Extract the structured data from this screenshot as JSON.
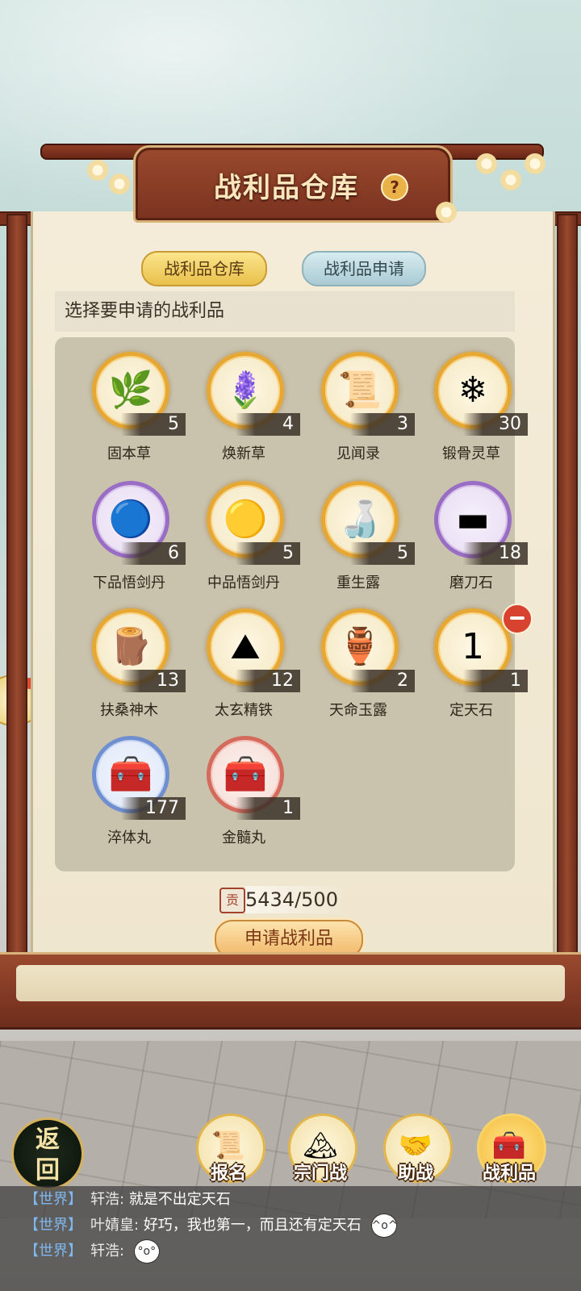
{
  "header": {
    "title": "战利品仓库",
    "help_label": "?"
  },
  "tabs": [
    {
      "label": "战利品仓库",
      "active": true
    },
    {
      "label": "战利品申请",
      "active": false
    }
  ],
  "hint": "选择要申请的战利品",
  "items": [
    {
      "name": "固本草",
      "count": "5",
      "icon": "herb-icon",
      "glyph": "🌿",
      "rarity": "gold"
    },
    {
      "name": "焕新草",
      "count": "4",
      "icon": "blue-flower-icon",
      "glyph": "🪻",
      "rarity": "gold"
    },
    {
      "name": "见闻录",
      "count": "3",
      "icon": "book-icon",
      "glyph": "📜",
      "rarity": "gold"
    },
    {
      "name": "锻骨灵草",
      "count": "30",
      "icon": "ice-flower-icon",
      "glyph": "❄",
      "rarity": "gold"
    },
    {
      "name": "下品悟剑丹",
      "count": "6",
      "icon": "teal-orb-icon",
      "glyph": "🔵",
      "rarity": "purple"
    },
    {
      "name": "中品悟剑丹",
      "count": "5",
      "icon": "gold-orb-icon",
      "glyph": "🟡",
      "rarity": "gold"
    },
    {
      "name": "重生露",
      "count": "5",
      "icon": "gourd-bottle-icon",
      "glyph": "🍶",
      "rarity": "gold"
    },
    {
      "name": "磨刀石",
      "count": "18",
      "icon": "whetstone-icon",
      "glyph": "▬",
      "rarity": "purple"
    },
    {
      "name": "扶桑神木",
      "count": "13",
      "icon": "wood-log-icon",
      "glyph": "🪵",
      "rarity": "gold"
    },
    {
      "name": "太玄精铁",
      "count": "12",
      "icon": "iron-ore-icon",
      "glyph": "⛰",
      "rarity": "gold"
    },
    {
      "name": "天命玉露",
      "count": "2",
      "icon": "jade-vase-icon",
      "glyph": "🏺",
      "rarity": "gold"
    },
    {
      "name": "定天石",
      "count": "1",
      "icon": "sky-stone-icon",
      "glyph": "1",
      "rarity": "gold",
      "selected": true
    },
    {
      "name": "淬体丸",
      "count": "177",
      "icon": "purple-pill-chest-icon",
      "glyph": "🧰",
      "rarity": "blue"
    },
    {
      "name": "金髓丸",
      "count": "1",
      "icon": "gold-pill-chest-icon",
      "glyph": "🧰",
      "rarity": "red"
    }
  ],
  "currency": {
    "value": "5434/500",
    "icon_label": "贡"
  },
  "apply_button": "申请战利品",
  "back_button": {
    "line1": "返",
    "line2": "回"
  },
  "nav": [
    {
      "label": "报名",
      "icon": "scroll-quill-icon",
      "glyph": "📜"
    },
    {
      "label": "宗门战",
      "icon": "mountain-flag-icon",
      "glyph": "🏔"
    },
    {
      "label": "助战",
      "icon": "handshake-icon",
      "glyph": "🤝"
    },
    {
      "label": "战利品",
      "icon": "treasure-chest-icon",
      "glyph": "🧰",
      "selected": true
    }
  ],
  "chat": [
    {
      "channel": "【世界】",
      "sender": "轩浩:",
      "text": "就是不出定天石",
      "emoji": ""
    },
    {
      "channel": "【世界】",
      "sender": "叶婧皇:",
      "text": "好巧，我也第一，而且还有定天石",
      "emoji": "^o^"
    },
    {
      "channel": "【世界】",
      "sender": "轩浩:",
      "text": "",
      "emoji": "°o°"
    }
  ]
}
